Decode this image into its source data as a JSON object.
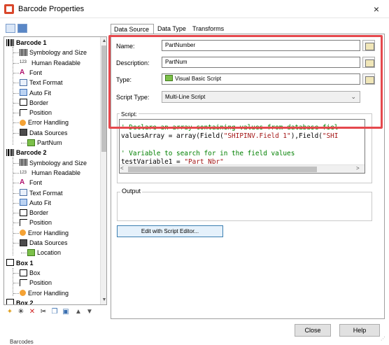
{
  "window": {
    "title": "Barcode Properties",
    "close_glyph": "×"
  },
  "tree": {
    "items": [
      {
        "label": "Barcode 1",
        "icon": "barcode-icon",
        "level": 0,
        "bold": true
      },
      {
        "label": "Symbology and Size",
        "icon": "symbology-icon",
        "level": 1
      },
      {
        "label": "Human Readable",
        "icon": "human-readable-icon",
        "level": 1
      },
      {
        "label": "Font",
        "icon": "font-icon",
        "level": 1
      },
      {
        "label": "Text Format",
        "icon": "text-format-icon",
        "level": 1
      },
      {
        "label": "Auto Fit",
        "icon": "auto-fit-icon",
        "level": 1
      },
      {
        "label": "Border",
        "icon": "border-icon",
        "level": 1
      },
      {
        "label": "Position",
        "icon": "position-icon",
        "level": 1
      },
      {
        "label": "Error Handling",
        "icon": "error-handling-icon",
        "level": 1
      },
      {
        "label": "Data Sources",
        "icon": "data-sources-icon",
        "level": 1
      },
      {
        "label": "PartNum",
        "icon": "field-icon",
        "level": 2
      },
      {
        "label": "Barcode 2",
        "icon": "barcode-icon",
        "level": 0,
        "bold": true
      },
      {
        "label": "Symbology and Size",
        "icon": "symbology-icon",
        "level": 1
      },
      {
        "label": "Human Readable",
        "icon": "human-readable-icon",
        "level": 1
      },
      {
        "label": "Font",
        "icon": "font-icon",
        "level": 1
      },
      {
        "label": "Text Format",
        "icon": "text-format-icon",
        "level": 1
      },
      {
        "label": "Auto Fit",
        "icon": "auto-fit-icon",
        "level": 1
      },
      {
        "label": "Border",
        "icon": "border-icon",
        "level": 1
      },
      {
        "label": "Position",
        "icon": "position-icon",
        "level": 1
      },
      {
        "label": "Error Handling",
        "icon": "error-handling-icon",
        "level": 1
      },
      {
        "label": "Data Sources",
        "icon": "data-sources-icon",
        "level": 1
      },
      {
        "label": "Location",
        "icon": "field-icon",
        "level": 2
      },
      {
        "label": "Box 1",
        "icon": "box-icon",
        "level": 0,
        "bold": true
      },
      {
        "label": "Box",
        "icon": "box-icon",
        "level": 1
      },
      {
        "label": "Position",
        "icon": "position-icon",
        "level": 1
      },
      {
        "label": "Error Handling",
        "icon": "error-handling-icon",
        "level": 1
      },
      {
        "label": "Box 2",
        "icon": "box-icon",
        "level": 0,
        "bold": true
      }
    ]
  },
  "tabs": [
    {
      "label": "Data Source",
      "active": true
    },
    {
      "label": "Data Type",
      "active": false
    },
    {
      "label": "Transforms",
      "active": false
    }
  ],
  "fields": {
    "name_label": "Name:",
    "name_value": "PartNumber",
    "description_label": "Description:",
    "description_value": "PartNum",
    "type_label": "Type:",
    "type_value": "Visual Basic Script",
    "script_type_label": "Script Type:",
    "script_type_value": "Multi-Line Script"
  },
  "script": {
    "label": "Script:",
    "line1": "' Declare an array containing values from database fiel",
    "line2_pre": "valuesArray = array(Field(",
    "line2_str1": "\"SHIPINV.Field 1\"",
    "line2_mid": "),Field(",
    "line2_str2": "\"SHI",
    "line3": "",
    "line4": "' Variable to search for in the field values",
    "line5_pre": "testVariable1 = ",
    "line5_str": "\"Part_Nbr\""
  },
  "output": {
    "label": "Output"
  },
  "buttons": {
    "edit_script": "Edit with Script Editor...",
    "close": "Close",
    "help": "Help"
  },
  "partial_bottom_text": "Barcodes",
  "colors": {
    "highlight": "#e5484d",
    "comment": "#008000",
    "string": "#a31515",
    "accent": "#3c7fb1"
  }
}
